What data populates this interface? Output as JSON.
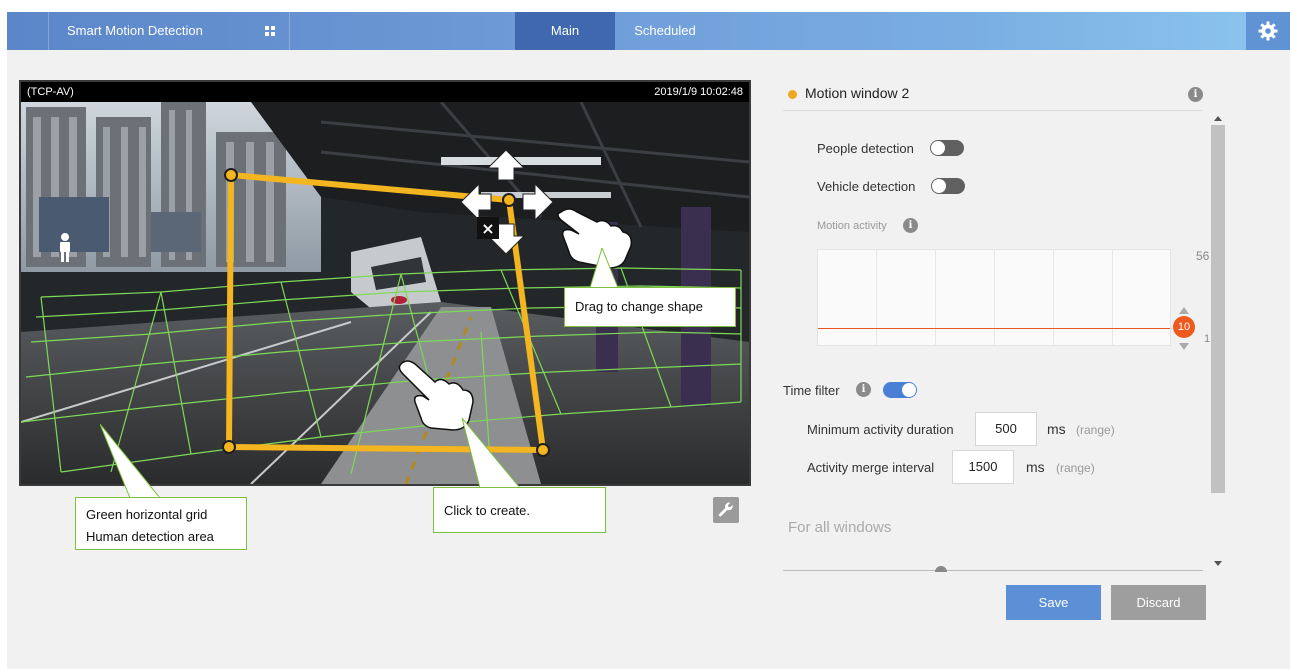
{
  "header": {
    "app_title": "Smart Motion Detection",
    "tabs": [
      {
        "label": "Main",
        "active": true
      },
      {
        "label": "Scheduled",
        "active": false
      }
    ],
    "settings_icon": "gear-icon",
    "accent": "#3f68ae"
  },
  "video": {
    "stream_label": "(TCP-AV)",
    "timestamp": "2019/1/9 10:02:48",
    "motion_window_color": "#f3b520",
    "grid_color": "#7ed957"
  },
  "callouts": {
    "grid_line1": "Green horizontal grid",
    "grid_line2": "Human detection area",
    "create": "Click to create.",
    "drag": "Drag to change shape"
  },
  "panel": {
    "window_title": "Motion window 2",
    "people_detection": {
      "label": "People detection",
      "on": false
    },
    "vehicle_detection": {
      "label": "Vehicle detection",
      "on": false
    },
    "motion_activity_label": "Motion activity",
    "chart": {
      "max": "56",
      "min": "1",
      "threshold": "10"
    },
    "time_filter": {
      "label": "Time filter",
      "on": true
    },
    "min_duration": {
      "label": "Minimum activity duration",
      "value": "500",
      "unit": "ms",
      "range": "(range)"
    },
    "merge_interval": {
      "label": "Activity merge interval",
      "value": "1500",
      "unit": "ms",
      "range": "(range)"
    },
    "all_windows_title": "For all windows"
  },
  "actions": {
    "save": "Save",
    "discard": "Discard"
  }
}
